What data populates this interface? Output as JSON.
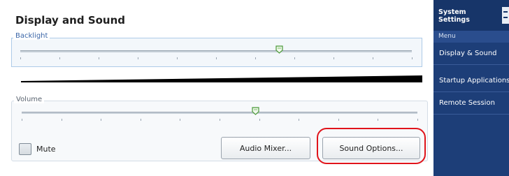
{
  "main": {
    "title": "Display and Sound",
    "backlight": {
      "label": "Backlight",
      "level_fraction": 0.66
    },
    "volume": {
      "label": "Volume",
      "level_fraction": 0.59
    },
    "mute": {
      "label": "Mute",
      "checked": false
    },
    "buttons": {
      "audio_mixer": "Audio Mixer...",
      "sound_options": "Sound Options..."
    },
    "highlight_color": "#e0141b"
  },
  "side": {
    "title_line1": "System",
    "title_line2": "Settings",
    "menu_caption": "Menu",
    "items": [
      {
        "label": "Display & Sound",
        "active": true
      },
      {
        "label": "Startup Applications",
        "active": false
      },
      {
        "label": "Remote Session",
        "active": false
      }
    ],
    "accent_color": "#ff9a12",
    "background_color": "#1d3e78"
  }
}
